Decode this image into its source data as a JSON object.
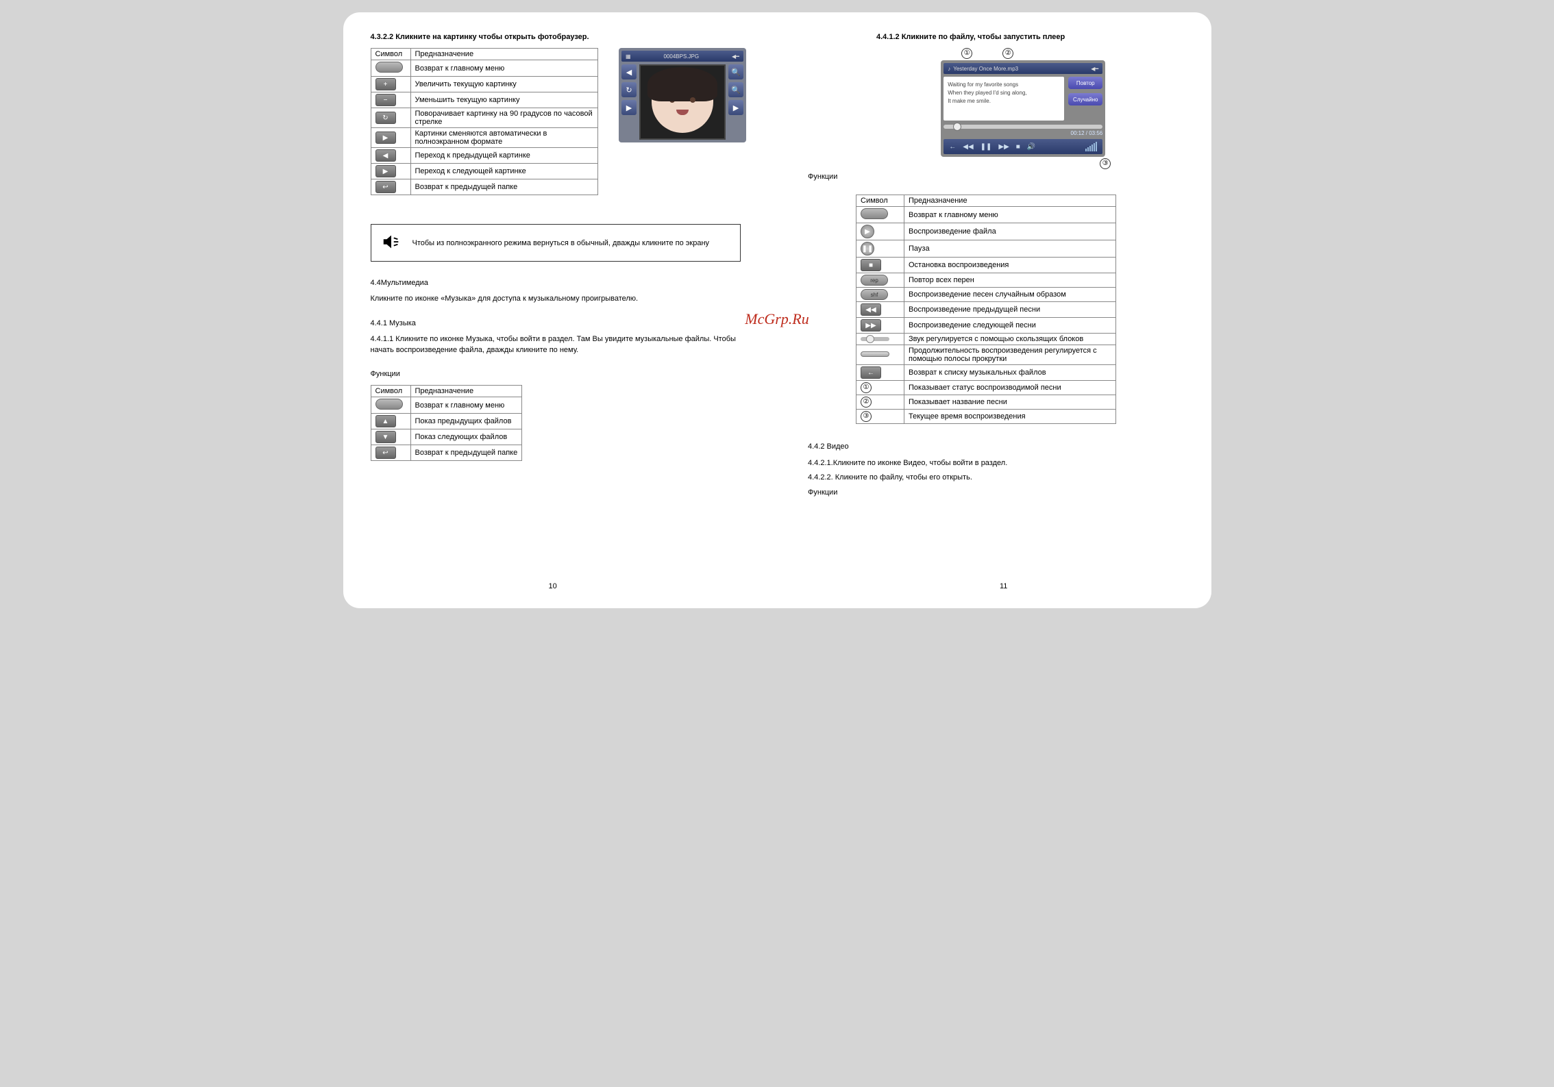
{
  "watermark": "McGrp.Ru",
  "left": {
    "h_4322": "4.3.2.2 Кликните на картинку чтобы открыть фотобраузер.",
    "table1": {
      "head": {
        "c1": "Символ",
        "c2": "Предназначение"
      },
      "rows": [
        {
          "desc": "Возврат к главному меню"
        },
        {
          "desc": "Увеличить текущую картинку"
        },
        {
          "desc": "Уменьшить текущую картинку"
        },
        {
          "desc": "Поворачивает картинку на 90 градусов по часовой стрелке"
        },
        {
          "desc": "Картинки сменяются автоматически в полноэкранном формате"
        },
        {
          "desc": "Переход к предыдущей картинке"
        },
        {
          "desc": "Переход к следующей картинке"
        },
        {
          "desc": "Возврат к предыдущей папке"
        }
      ]
    },
    "browser_title": "0004BPS.JPG",
    "tip": "Чтобы из полноэкранного режима вернуться в обычный, дважды кликните по экрану",
    "h_44": "4.4Мультимедиа",
    "p_44": "Кликните по иконке «Музыка» для доступа к музыкальному проигрывателю.",
    "h_441": "4.4.1 Музыка",
    "p_4411": "4.4.1.1 Кликните по иконке Музыка, чтобы войти в раздел. Там Вы увидите музыкальные файлы. Чтобы начать воспроизведение файла, дважды кликните по нему.",
    "func_label": "Функции",
    "table2": {
      "head": {
        "c1": "Символ",
        "c2": "Предназначение"
      },
      "rows": [
        {
          "desc": "Возврат к главному меню"
        },
        {
          "desc": "Показ предыдущих файлов"
        },
        {
          "desc": "Показ следующих файлов"
        },
        {
          "desc": "Возврат к предыдущей папке"
        }
      ]
    },
    "pagenum": "10"
  },
  "right": {
    "h_4412": "4.4.1.2 Кликните по файлу, чтобы запустить плеер",
    "callouts": {
      "c1": "①",
      "c2": "②",
      "c3": "③"
    },
    "player": {
      "title": "Yesterday Once More.mp3",
      "lyrics": {
        "l1": "Waiting for my favorite songs",
        "l2": "When they played I'd sing along,",
        "l3": "It make me smile."
      },
      "btn1": "Повтор",
      "btn2": "Случайно",
      "time": "00:12 / 03:56"
    },
    "func_label": "Функции",
    "table3": {
      "head": {
        "c1": "Символ",
        "c2": "Предназначение"
      },
      "rows": [
        {
          "desc": "Возврат к главному меню"
        },
        {
          "desc": "Воспроизведение файла"
        },
        {
          "desc": "Пауза"
        },
        {
          "desc": "Остановка воспроизведения"
        },
        {
          "desc": "Повтор всех перен"
        },
        {
          "desc": "Воспроизведение песен случайным образом"
        },
        {
          "desc": "Воспроизведение предыдущей песни"
        },
        {
          "desc": "Воспроизведение следующей песни"
        },
        {
          "desc": "Звук регулируется с помощью скользящих блоков"
        },
        {
          "desc": "Продолжительность воспроизведения регулируется с помощью полосы прокрутки"
        },
        {
          "desc": "Возврат к списку музыкальных файлов"
        },
        {
          "sym": "①",
          "desc": "Показывает статус воспроизводимой песни"
        },
        {
          "sym": "②",
          "desc": "Показывает название песни"
        },
        {
          "sym": "③",
          "desc": "Текущее время воспроизведения"
        }
      ]
    },
    "h_442": "4.4.2 Видео",
    "p_4421": "4.4.2.1.Кликните по иконке Видео, чтобы войти в раздел.",
    "p_4422": "4.4.2.2. Кликните по файлу, чтобы его открыть.",
    "func_label2": "Функции",
    "pagenum": "11"
  }
}
